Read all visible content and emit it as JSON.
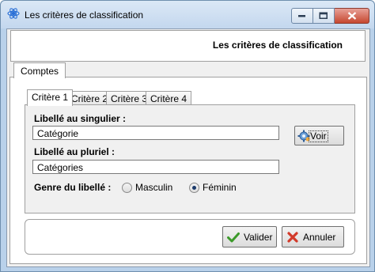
{
  "window": {
    "title": "Les critères de classification",
    "accent": "#c3d7ee",
    "close_color": "#c6472f"
  },
  "header": {
    "title": "Les critères de classification"
  },
  "tabs": {
    "main": [
      {
        "label": "Comptes",
        "active": true
      }
    ],
    "sub": [
      {
        "label": "Critère 1",
        "active": true
      },
      {
        "label": "Critère 2",
        "active": false
      },
      {
        "label": "Critère 3",
        "active": false
      },
      {
        "label": "Critère 4",
        "active": false
      }
    ]
  },
  "form": {
    "singulier_label": "Libellé au singulier :",
    "singulier_value": "Catégorie",
    "pluriel_label": "Libellé au pluriel :",
    "pluriel_value": "Catégories",
    "genre_label": "Genre du libellé :",
    "genre_options": [
      {
        "label": "Masculin",
        "selected": false
      },
      {
        "label": "Féminin",
        "selected": true
      }
    ],
    "voir_label": "Voir",
    "voir_icon": "gear-icon"
  },
  "actions": {
    "valider_label": "Valider",
    "valider_icon": "checkmark-icon",
    "annuler_label": "Annuler",
    "annuler_icon": "cross-icon"
  }
}
